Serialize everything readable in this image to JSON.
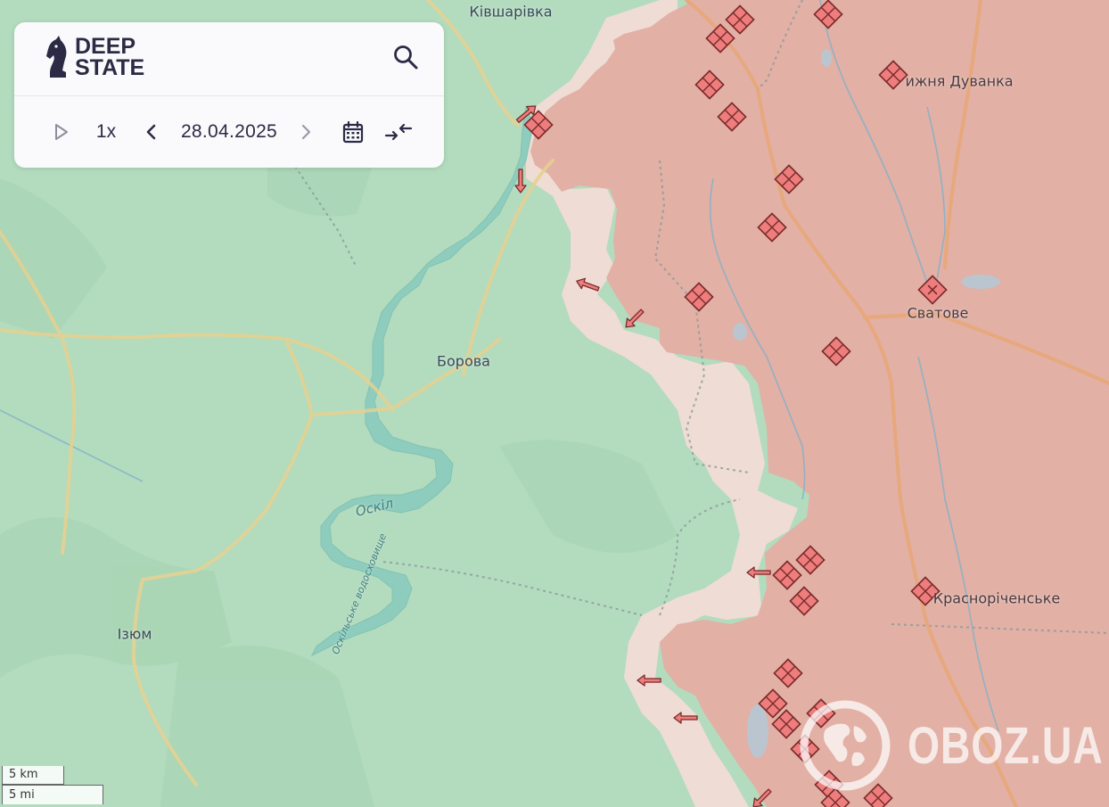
{
  "brand": {
    "line1": "DEEP",
    "line2": "STATE"
  },
  "toolbar": {
    "speed": "1x",
    "date": "28.04.2025"
  },
  "icons": {
    "search": "search-icon",
    "play": "play-icon",
    "prev": "chevron-left-icon",
    "next": "chevron-right-icon",
    "calendar": "calendar-icon",
    "compare": "compare-arrows-icon"
  },
  "places": {
    "kivsharivka": "Ківшарівка",
    "nyzhnia_duvanka": "ижня Дуванка",
    "svatove": "Сватове",
    "borova": "Борова",
    "oskil": "Оскіл",
    "reservoir": "Оскільське водосховище",
    "izium": "Ізюм",
    "krasnorichenske": "Красноріченське"
  },
  "scale": {
    "km": "5 km",
    "mi": "5 mi"
  },
  "watermark": {
    "text": "OBOZ.UA"
  },
  "colors": {
    "ukraine_control": "#b3dbbe",
    "occupied": "#e2b0a5",
    "grey_zone": "#efdcd4",
    "water": "#8ecdbd",
    "road": "#e6d190",
    "road_occupied": "#e8a775",
    "marker": "#ee7d7d",
    "marker_stroke": "#7a2a2a",
    "brand": "#2c2b45"
  }
}
